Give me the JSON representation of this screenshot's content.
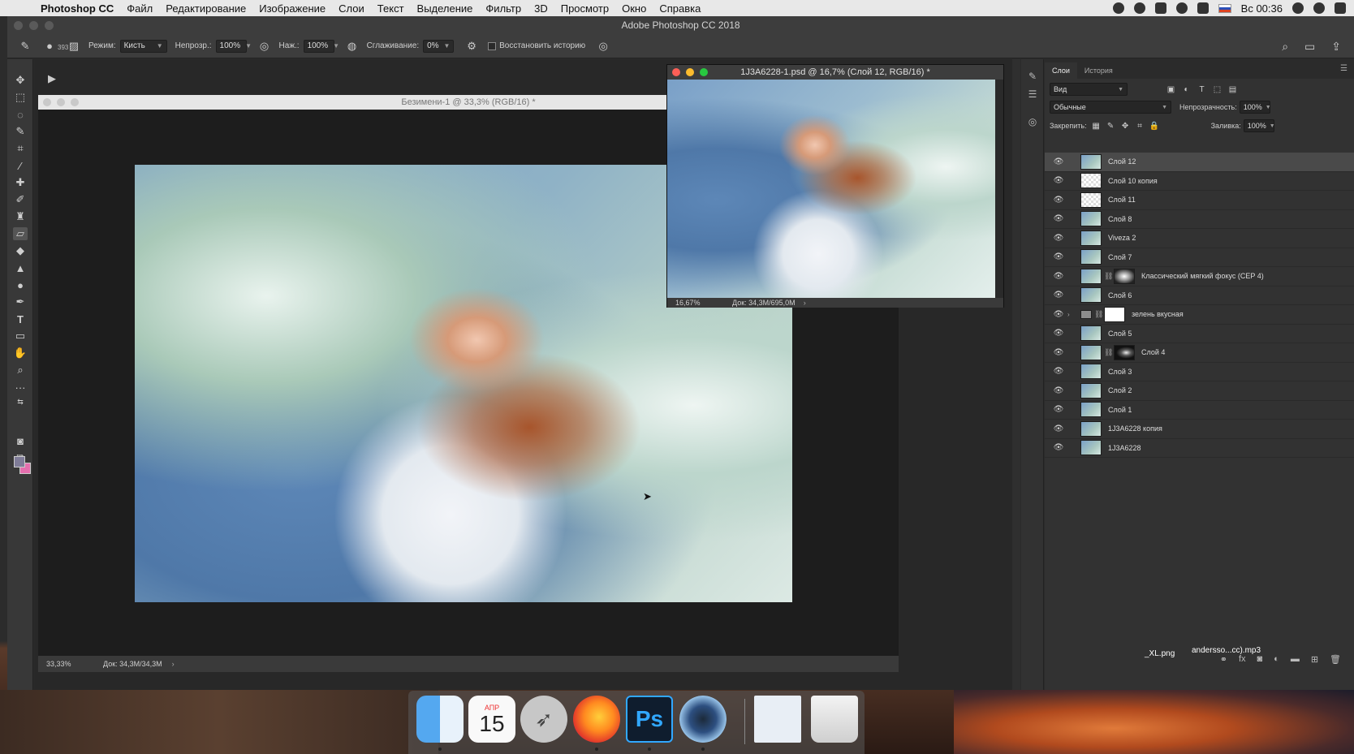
{
  "menubar": {
    "app_name": "Photoshop CC",
    "items": [
      "Файл",
      "Редактирование",
      "Изображение",
      "Слои",
      "Текст",
      "Выделение",
      "Фильтр",
      "3D",
      "Просмотр",
      "Окно",
      "Справка"
    ],
    "clock": "Вс 00:36"
  },
  "window": {
    "title": "Adobe Photoshop CC 2018"
  },
  "options_bar": {
    "brush_size": "393",
    "mode_label": "Режим:",
    "mode_value": "Кисть",
    "opacity_label": "Непрозр.:",
    "opacity_value": "100%",
    "pressure_label": "Наж.:",
    "pressure_value": "100%",
    "smoothing_label": "Сглаживание:",
    "smoothing_value": "0%",
    "restore_history_label": "Восстановить историю"
  },
  "doc1": {
    "title": "Безимени-1 @ 33,3% (RGB/16) *",
    "zoom": "33,33%",
    "doc_size": "Док: 34,3M/34,3M"
  },
  "doc2": {
    "title": "1J3A6228-1.psd @ 16,7% (Слой 12, RGB/16) *",
    "zoom": "16,67%",
    "doc_size": "Док: 34,3M/695,0M"
  },
  "layers_panel": {
    "tabs": [
      "Слои",
      "История"
    ],
    "filter_value": "Вид",
    "blend_mode": "Обычные",
    "opacity_label": "Непрозрачность:",
    "opacity_value": "100%",
    "lock_label": "Закрепить:",
    "fill_label": "Заливка:",
    "fill_value": "100%",
    "layers": [
      {
        "name": "Слой 12",
        "selected": true,
        "thumb": "photo"
      },
      {
        "name": "Слой 10 копия",
        "thumb": "checker"
      },
      {
        "name": "Слой 11",
        "thumb": "checker"
      },
      {
        "name": "Слой 8",
        "thumb": "photo"
      },
      {
        "name": "Viveza 2",
        "thumb": "photo"
      },
      {
        "name": "Слой 7",
        "thumb": "photo"
      },
      {
        "name": "Классический мягкий фокус (CEP 4)",
        "thumb": "photo",
        "mask": "soft"
      },
      {
        "name": "Слой 6",
        "thumb": "photo"
      },
      {
        "name": "зелень вкусная",
        "thumb": "folder",
        "mask": "white",
        "group": true
      },
      {
        "name": "Слой 5",
        "thumb": "photo"
      },
      {
        "name": "Слой 4",
        "thumb": "photo",
        "mask": "dark"
      },
      {
        "name": "Слой 3",
        "thumb": "photo"
      },
      {
        "name": "Слой 2",
        "thumb": "photo"
      },
      {
        "name": "Слой 1",
        "thumb": "photo"
      },
      {
        "name": "1J3A6228 копия",
        "thumb": "photo"
      },
      {
        "name": "1J3A6228",
        "thumb": "photo"
      }
    ]
  },
  "dock": {
    "calendar_month": "АПР",
    "calendar_day": "15",
    "ps_label": "Ps"
  },
  "desktop": {
    "file1": "_XL.png",
    "file2": "andersso...cc).mp3"
  },
  "colors": {
    "foreground": "#7f7c98",
    "background": "#e56fae",
    "ps_accent": "#31a8ff"
  }
}
